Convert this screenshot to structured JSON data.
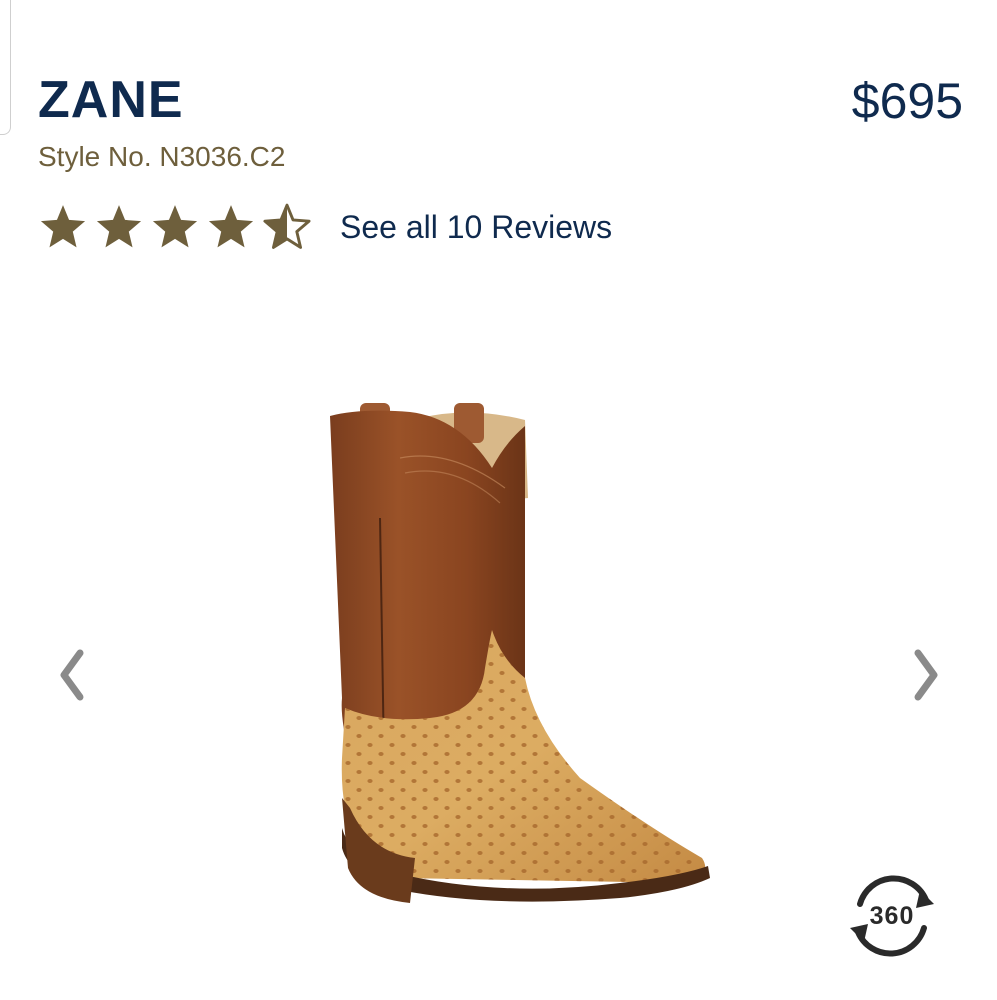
{
  "product": {
    "name": "ZANE",
    "price": "$695",
    "style_no": "Style No. N3036.C2"
  },
  "rating": {
    "value": 4.5,
    "max": 5,
    "reviews_link": "See all 10 Reviews"
  },
  "carousel": {
    "prev_icon": "chevron-left-icon",
    "next_icon": "chevron-right-icon",
    "image": "cowboy-boot-ostrich",
    "badge_360": "360"
  },
  "colors": {
    "navy": "#0f2a4e",
    "gold": "#6e5f3c",
    "star": "#6e5f3c"
  }
}
